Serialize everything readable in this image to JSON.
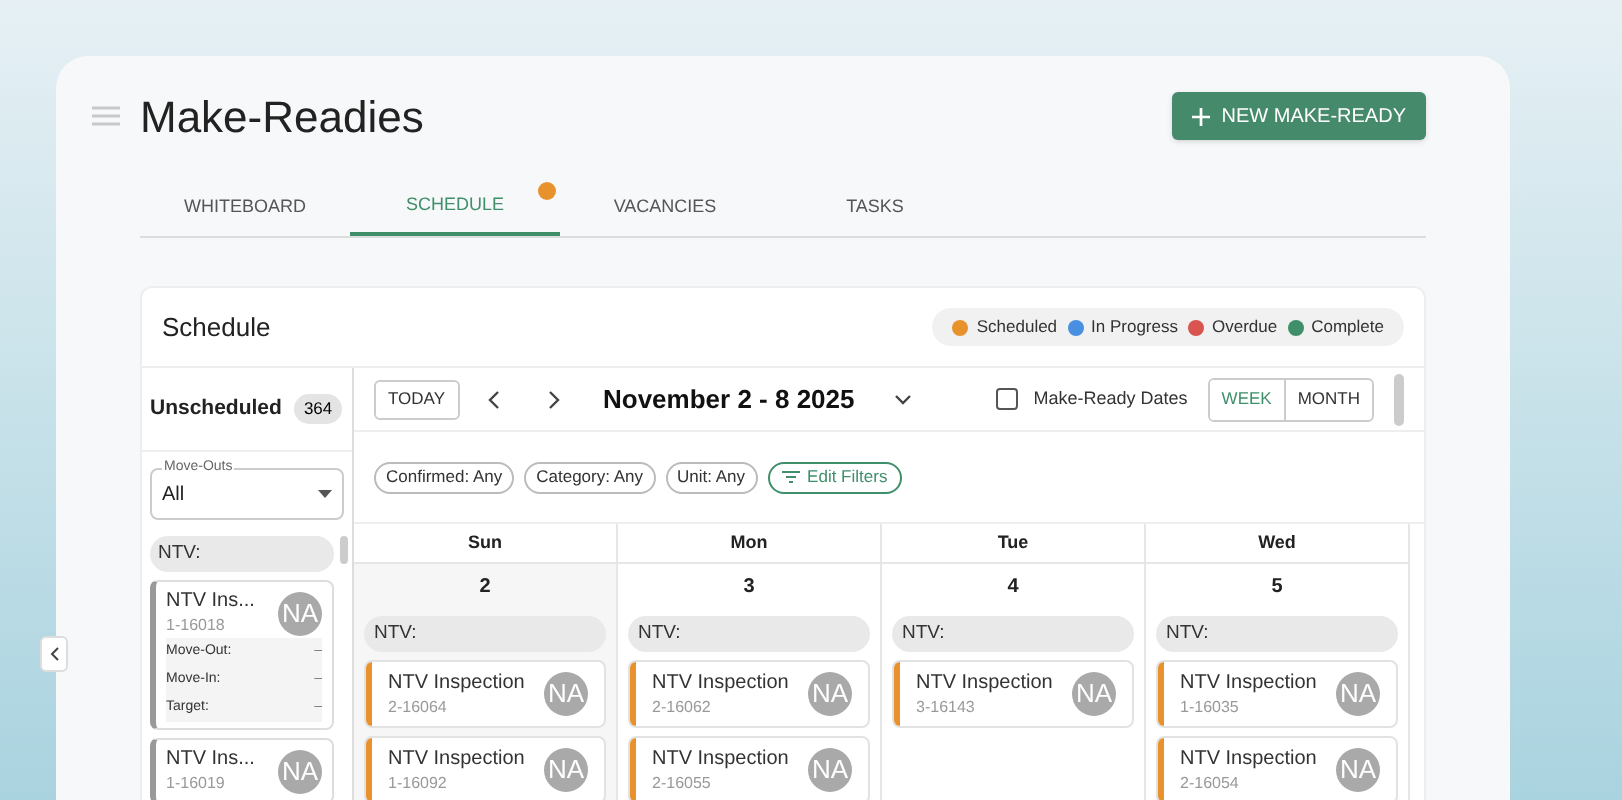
{
  "page": {
    "title": "Make-Readies",
    "action": "NEW MAKE-READY"
  },
  "tabs": [
    {
      "label": "WHITEBOARD",
      "selected": false,
      "badge": false
    },
    {
      "label": "SCHEDULE",
      "selected": true,
      "badge": true
    },
    {
      "label": "VACANCIES",
      "selected": false,
      "badge": false
    },
    {
      "label": "TASKS",
      "selected": false,
      "badge": false
    }
  ],
  "schedule": {
    "title": "Schedule",
    "legend": [
      {
        "label": "Scheduled",
        "color": "#e8922d"
      },
      {
        "label": "In Progress",
        "color": "#4a90e2"
      },
      {
        "label": "Overdue",
        "color": "#d9534f"
      },
      {
        "label": "Complete",
        "color": "#3f8f6b"
      }
    ]
  },
  "unscheduled": {
    "title": "Unscheduled",
    "count": "364",
    "filter": {
      "label": "Move-Outs",
      "value": "All"
    },
    "group": "NTV:",
    "cards": [
      {
        "title": "NTV Ins...",
        "unit": "1-16018",
        "avatar": "NA",
        "details": [
          {
            "label": "Move-Out:",
            "value": "–"
          },
          {
            "label": "Move-In:",
            "value": "–"
          },
          {
            "label": "Target:",
            "value": "–"
          }
        ]
      },
      {
        "title": "NTV Ins...",
        "unit": "1-16019",
        "avatar": "NA"
      }
    ]
  },
  "toolbar": {
    "today": "TODAY",
    "range": "November 2 - 8 2025",
    "checkbox": {
      "label": "Make-Ready Dates",
      "checked": false
    },
    "views": [
      {
        "label": "WEEK",
        "selected": true
      },
      {
        "label": "MONTH",
        "selected": false
      }
    ]
  },
  "filters": [
    {
      "label": "Confirmed: Any",
      "kind": "chip"
    },
    {
      "label": "Category: Any",
      "kind": "chip"
    },
    {
      "label": "Unit: Any",
      "kind": "chip"
    },
    {
      "label": "Edit Filters",
      "kind": "action"
    }
  ],
  "days": [
    {
      "name": "Sun",
      "date": "2",
      "group": "NTV:",
      "events": [
        {
          "title": "NTV Inspection",
          "unit": "2-16064",
          "avatar": "NA",
          "color": "#e8922d"
        },
        {
          "title": "NTV Inspection",
          "unit": "1-16092",
          "avatar": "NA",
          "color": "#e8922d"
        }
      ]
    },
    {
      "name": "Mon",
      "date": "3",
      "group": "NTV:",
      "events": [
        {
          "title": "NTV Inspection",
          "unit": "2-16062",
          "avatar": "NA",
          "color": "#e8922d"
        },
        {
          "title": "NTV Inspection",
          "unit": "2-16055",
          "avatar": "NA",
          "color": "#e8922d"
        }
      ]
    },
    {
      "name": "Tue",
      "date": "4",
      "group": "NTV:",
      "events": [
        {
          "title": "NTV Inspection",
          "unit": "3-16143",
          "avatar": "NA",
          "color": "#e8922d"
        }
      ]
    },
    {
      "name": "Wed",
      "date": "5",
      "group": "NTV:",
      "events": [
        {
          "title": "NTV Inspection",
          "unit": "1-16035",
          "avatar": "NA",
          "color": "#e8922d"
        },
        {
          "title": "NTV Inspection",
          "unit": "2-16054",
          "avatar": "NA",
          "color": "#e8922d"
        }
      ]
    }
  ]
}
